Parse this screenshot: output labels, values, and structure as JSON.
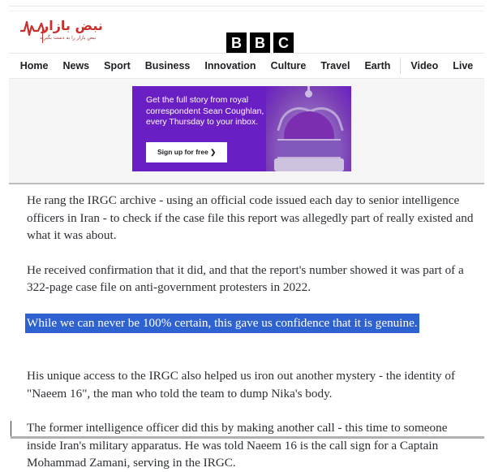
{
  "brand": {
    "name_fa": "نبض بازار",
    "tagline_fa": "نبض بازار را به دست بگیرید",
    "logo_color": "#c9302c",
    "pulse_icon": "heartbeat-icon"
  },
  "bbc_logo": {
    "letters": [
      "B",
      "B",
      "C"
    ],
    "block_color": "#000000",
    "letter_color": "#ffffff"
  },
  "nav": {
    "items": [
      {
        "label": "Home"
      },
      {
        "label": "News"
      },
      {
        "label": "Sport"
      },
      {
        "label": "Business"
      },
      {
        "label": "Innovation"
      },
      {
        "label": "Culture"
      },
      {
        "label": "Travel"
      },
      {
        "label": "Earth"
      },
      {
        "label": "Video"
      },
      {
        "label": "Live"
      }
    ],
    "divider_after_index": 7
  },
  "advert": {
    "copy": "Get the full story from royal correspondent Sean Coughlan, every Thursday to your inbox.",
    "cta_label": "Sign up for free  ❯",
    "background_color": "#6a1fc4",
    "image_alt": "crown-image"
  },
  "article": {
    "paragraphs": [
      "He rang the IRGC archive - using an official code issued each day to senior intelligence officers in Iran - to check if the case file this report was allegedly part of really existed and what it was about.",
      "He received confirmation that it did, and that the report's number showed it was part of a 322-page case file on anti-government protesters in 2022.",
      "His unique access to the IRGC also helped us iron out another mystery - the identity of \"Naeem 16\", the man who told the team to dump Nika's body.",
      "The former intelligence officer did this by making another call - this time to someone inside Iran's military apparatus. He was told Naeem 16 is the call sign for a Captain Mohammad Zamani, serving in the IRGC."
    ],
    "selected_text": "While we can never be 100% certain, this gave us confidence that it is genuine.",
    "selection_background": "#2f62d1",
    "selection_color": "#ffffff"
  }
}
